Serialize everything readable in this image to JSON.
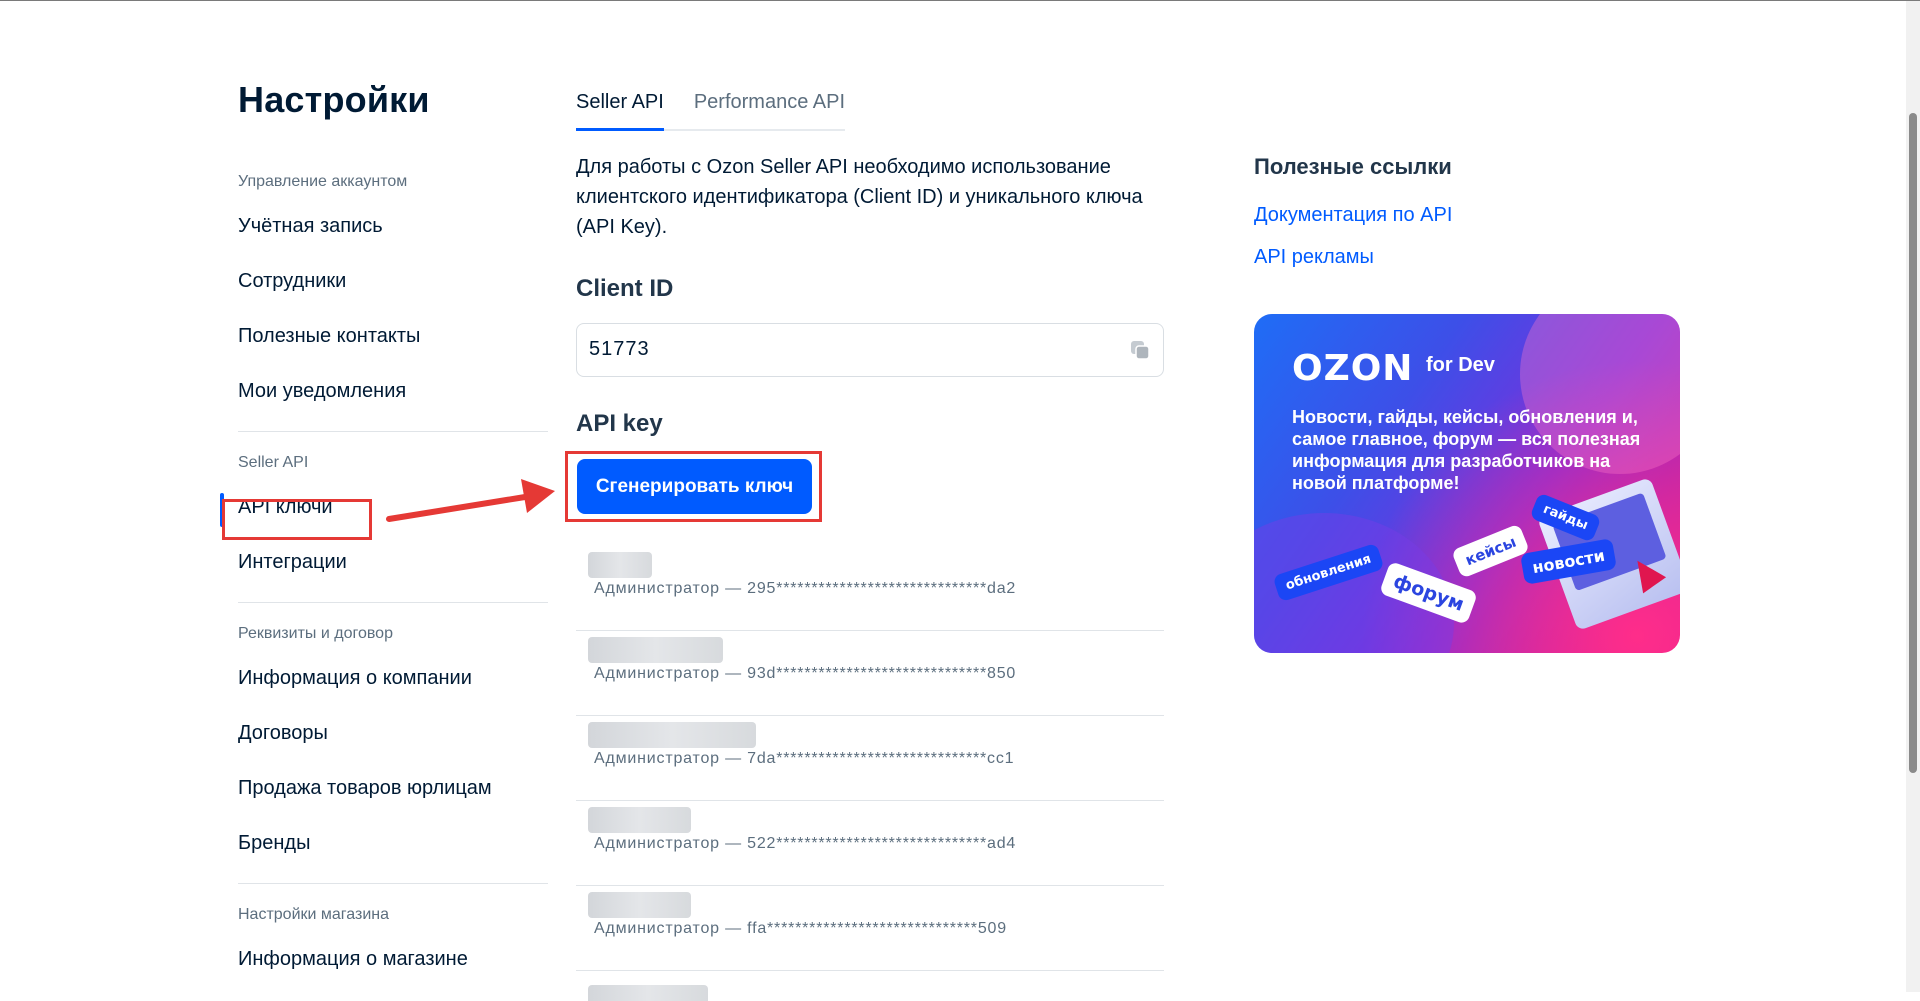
{
  "page": {
    "title": "Настройки"
  },
  "sidebar": {
    "groups": [
      {
        "title": "Управление аккаунтом",
        "items": [
          "Учётная запись",
          "Сотрудники",
          "Полезные контакты",
          "Мои уведомления"
        ]
      },
      {
        "title": "Seller API",
        "items": [
          "API ключи",
          "Интеграции"
        ]
      },
      {
        "title": "Реквизиты и договор",
        "items": [
          "Информация о компании",
          "Договоры",
          "Продажа товаров юрлицам",
          "Бренды"
        ]
      },
      {
        "title": "Настройки магазина",
        "items": [
          "Информация о магазине"
        ]
      }
    ],
    "active_item": "API ключи"
  },
  "tabs": [
    {
      "label": "Seller API",
      "active": true
    },
    {
      "label": "Performance API",
      "active": false
    }
  ],
  "main": {
    "intro": "Для работы с Ozon Seller API необходимо использование клиентского идентификатора (Client ID) и уникального ключа (API Key).",
    "client_id_title": "Client ID",
    "client_id_value": "51773",
    "api_key_title": "API key",
    "generate_button": "Сгенерировать ключ",
    "keys": [
      {
        "meta": "Администратор — 295******************************da2"
      },
      {
        "meta": "Администратор — 93d******************************850"
      },
      {
        "meta": "Администратор — 7da******************************cc1"
      },
      {
        "meta": "Администратор — 522******************************ad4"
      },
      {
        "meta": "Администратор — ffa******************************509"
      }
    ]
  },
  "useful_links": {
    "title": "Полезные ссылки",
    "links": [
      "Документация по API",
      "API рекламы"
    ]
  },
  "banner": {
    "logo": "OZON",
    "logo_sub": "for Dev",
    "text": "Новости, гайды, кейсы, обновления и, самое главное, форум — вся полезная информация для разработчиков на новой платформе!",
    "tags": [
      "обновления",
      "форум",
      "кейсы",
      "гайды",
      "новости"
    ]
  },
  "colors": {
    "accent": "#005bff",
    "annotation": "#e53935",
    "text": "#001a34",
    "muted": "#5c6e7e"
  },
  "icons": {
    "copy": "copy-icon"
  }
}
